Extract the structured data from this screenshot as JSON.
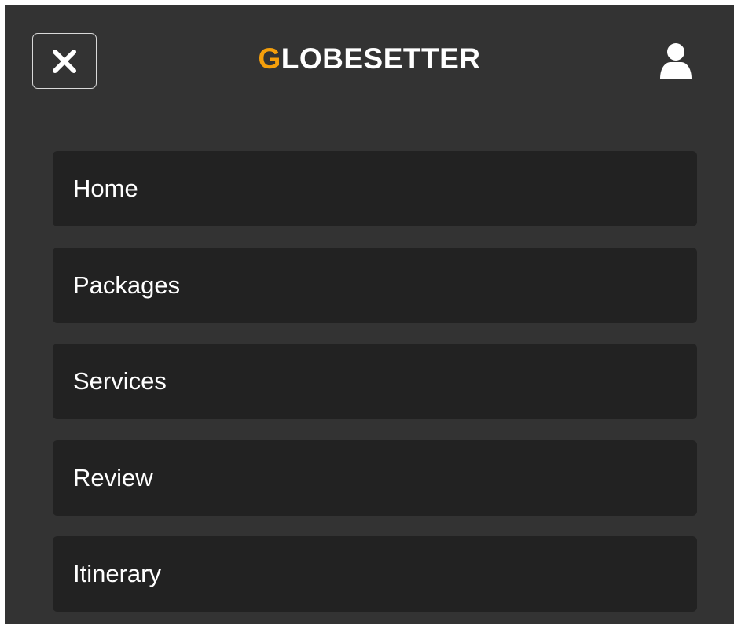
{
  "header": {
    "close_icon": "close-icon",
    "brand_first_letter": "G",
    "brand_rest": "LOBESETTER",
    "user_icon": "user-icon"
  },
  "colors": {
    "panel_bg": "#333333",
    "item_bg": "#222222",
    "accent": "#f59f0b",
    "text": "#ffffff"
  },
  "nav": {
    "items": [
      {
        "label": "Home"
      },
      {
        "label": "Packages"
      },
      {
        "label": "Services"
      },
      {
        "label": "Review"
      },
      {
        "label": "Itinerary"
      }
    ]
  }
}
